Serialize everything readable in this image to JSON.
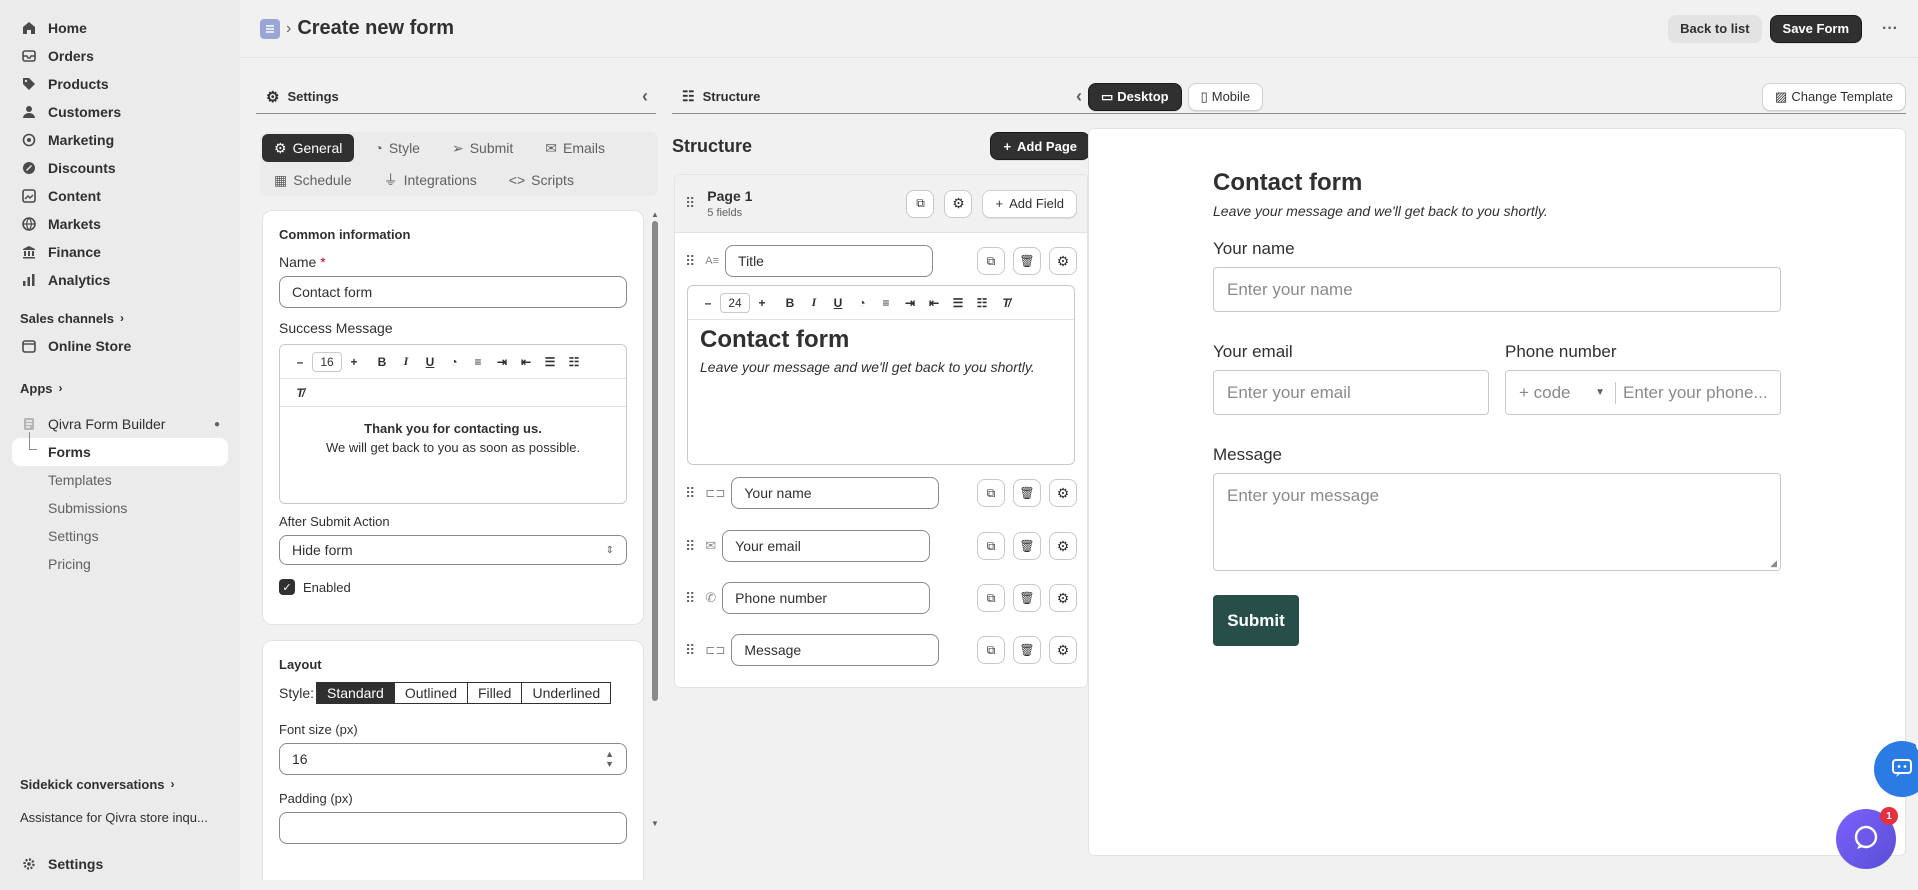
{
  "sidebar": {
    "items": [
      {
        "label": "Home",
        "icon": "home-icon"
      },
      {
        "label": "Orders",
        "icon": "orders-icon"
      },
      {
        "label": "Products",
        "icon": "tag-icon"
      },
      {
        "label": "Customers",
        "icon": "person-icon"
      },
      {
        "label": "Marketing",
        "icon": "target-icon"
      },
      {
        "label": "Discounts",
        "icon": "discount-icon"
      },
      {
        "label": "Content",
        "icon": "content-icon"
      },
      {
        "label": "Markets",
        "icon": "globe-icon"
      },
      {
        "label": "Finance",
        "icon": "bank-icon"
      },
      {
        "label": "Analytics",
        "icon": "chart-icon"
      }
    ],
    "sales_channels": "Sales channels",
    "online_store": "Online Store",
    "apps": "Apps",
    "app_name": "Qivra Form Builder",
    "app_subitems": [
      "Forms",
      "Templates",
      "Submissions",
      "Settings",
      "Pricing"
    ],
    "sidekick": "Sidekick conversations",
    "assistance": "Assistance for Qivra store inqu...",
    "settings": "Settings"
  },
  "topbar": {
    "breadcrumb_sep": "›",
    "title": "Create new form",
    "back": "Back to list",
    "save": "Save Form",
    "more": "···"
  },
  "settings": {
    "header": "Settings",
    "tabs": [
      "General",
      "Style",
      "Submit",
      "Emails",
      "Schedule",
      "Integrations",
      "Scripts"
    ],
    "common_info": "Common information",
    "name_label": "Name",
    "required_mark": "*",
    "name_value": "Contact form",
    "success_label": "Success Message",
    "font_size_value": "16",
    "success_line1": "Thank you for contacting us.",
    "success_line2": "We will get back to you as soon as possible.",
    "after_submit_label": "After Submit Action",
    "after_submit_value": "Hide form",
    "enabled_label": "Enabled",
    "layout_title": "Layout",
    "style_label": "Style:",
    "style_options": [
      "Standard",
      "Outlined",
      "Filled",
      "Underlined"
    ],
    "font_size_label": "Font size (px)",
    "font_size_px": "16",
    "padding_label": "Padding (px)"
  },
  "structure": {
    "header": "Structure",
    "title": "Structure",
    "add_page": "Add Page",
    "page_title": "Page 1",
    "page_sub": "5 fields",
    "add_field": "Add Field",
    "fields": [
      "Title",
      "Your name",
      "Your email",
      "Phone number",
      "Message"
    ],
    "editor_font_size": "24",
    "editor_heading": "Contact form",
    "editor_sub": "Leave your message and we'll get back to you shortly."
  },
  "preview": {
    "desktop": "Desktop",
    "mobile": "Mobile",
    "change_template": "Change Template",
    "form_title": "Contact form",
    "form_sub": "Leave your message and we'll get back to you shortly.",
    "name_label": "Your name",
    "name_ph": "Enter your name",
    "email_label": "Your email",
    "email_ph": "Enter your email",
    "phone_label": "Phone number",
    "code_ph": "+ code",
    "phone_ph": "Enter your phone...",
    "msg_label": "Message",
    "msg_ph": "Enter your message",
    "submit": "Submit",
    "chat_badge": "1"
  }
}
